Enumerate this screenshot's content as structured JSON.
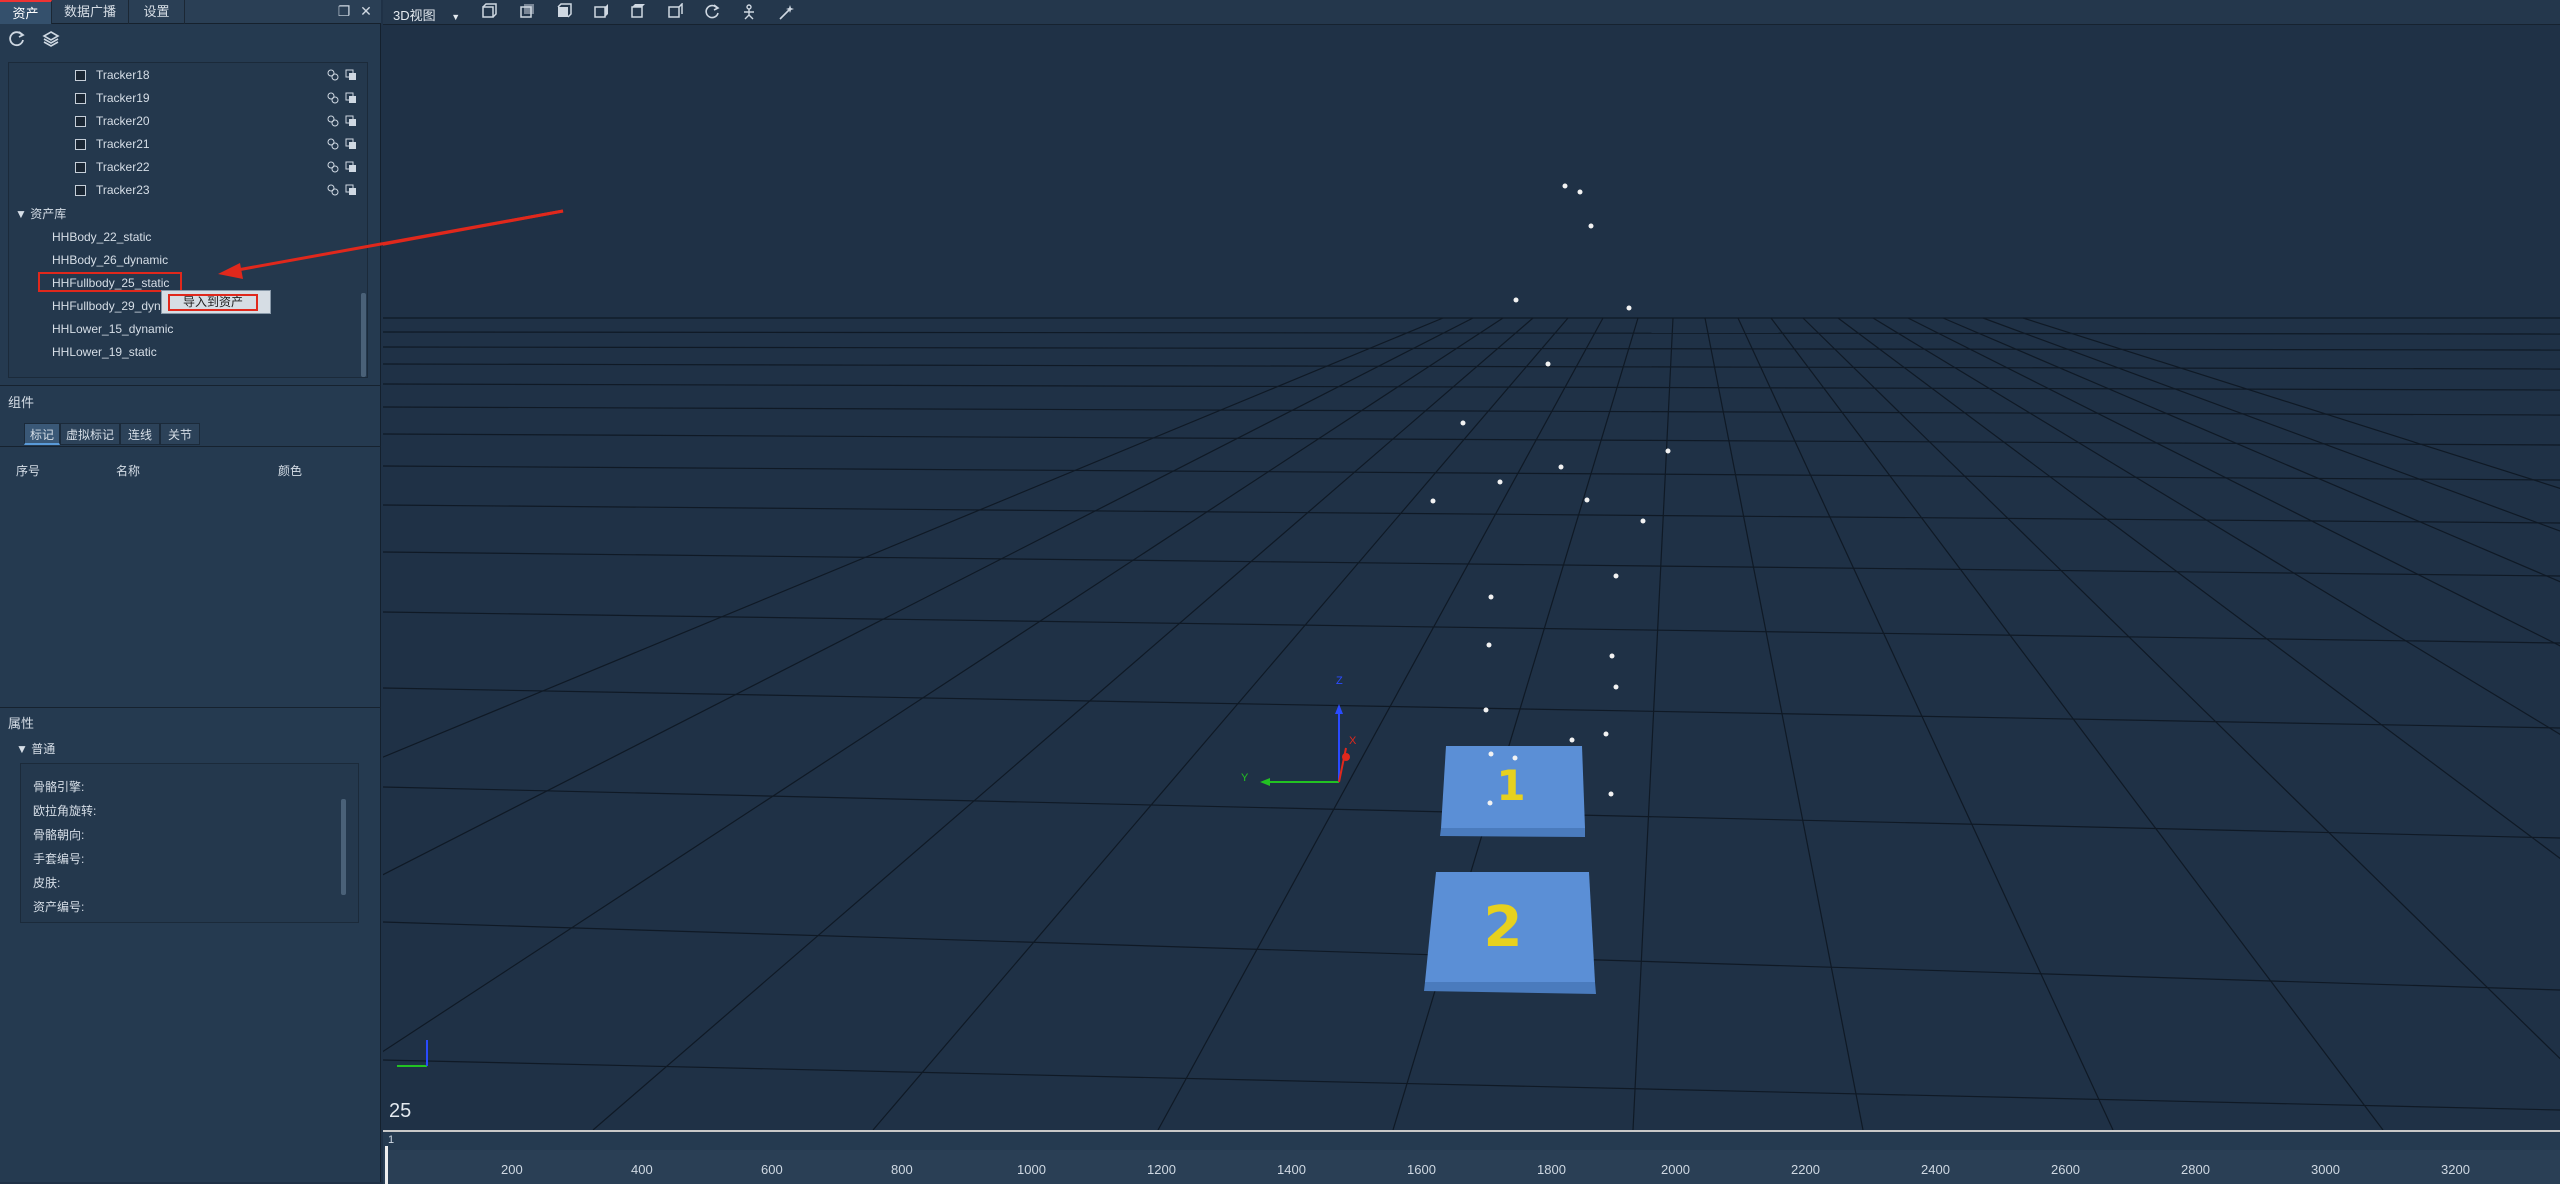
{
  "panel": {
    "tabs": [
      "资产",
      "数据广播",
      "设置"
    ],
    "trackers": [
      "Tracker18",
      "Tracker19",
      "Tracker20",
      "Tracker21",
      "Tracker22",
      "Tracker23"
    ],
    "library_title": "资产库",
    "library_items": [
      "HHBody_22_static",
      "HHBody_26_dynamic",
      "HHFullbody_25_static",
      "HHFullbody_29_dyn",
      "HHLower_15_dynamic",
      "HHLower_19_static"
    ],
    "context_menu_item": "导入到资产"
  },
  "components": {
    "title": "组件",
    "tabs": [
      "标记",
      "虚拟标记",
      "连线",
      "关节"
    ],
    "columns": [
      "序号",
      "名称",
      "颜色"
    ]
  },
  "properties": {
    "title": "属性",
    "group": "普通",
    "fields": [
      "骨骼引擎:",
      "欧拉角旋转:",
      "骨骼朝向:",
      "手套编号:",
      "皮肤:",
      "资产编号:"
    ]
  },
  "viewport": {
    "view_mode": "3D视图",
    "frame": "25",
    "axis_y": "Y",
    "axis_z": "Z",
    "axis_x": "X",
    "plate_labels": [
      "1",
      "2"
    ]
  },
  "timeline": {
    "start": "1",
    "ticks": [
      "200",
      "400",
      "600",
      "800",
      "1000",
      "1200",
      "1400",
      "1600",
      "1800",
      "2000",
      "2200",
      "2400",
      "2600",
      "2800",
      "3000",
      "3200"
    ]
  },
  "colors": {
    "accent_red": "#e0281c",
    "viewport_bg": "#1f3146",
    "plate": "#5b8fd6",
    "plate_label": "#e7d11e"
  }
}
